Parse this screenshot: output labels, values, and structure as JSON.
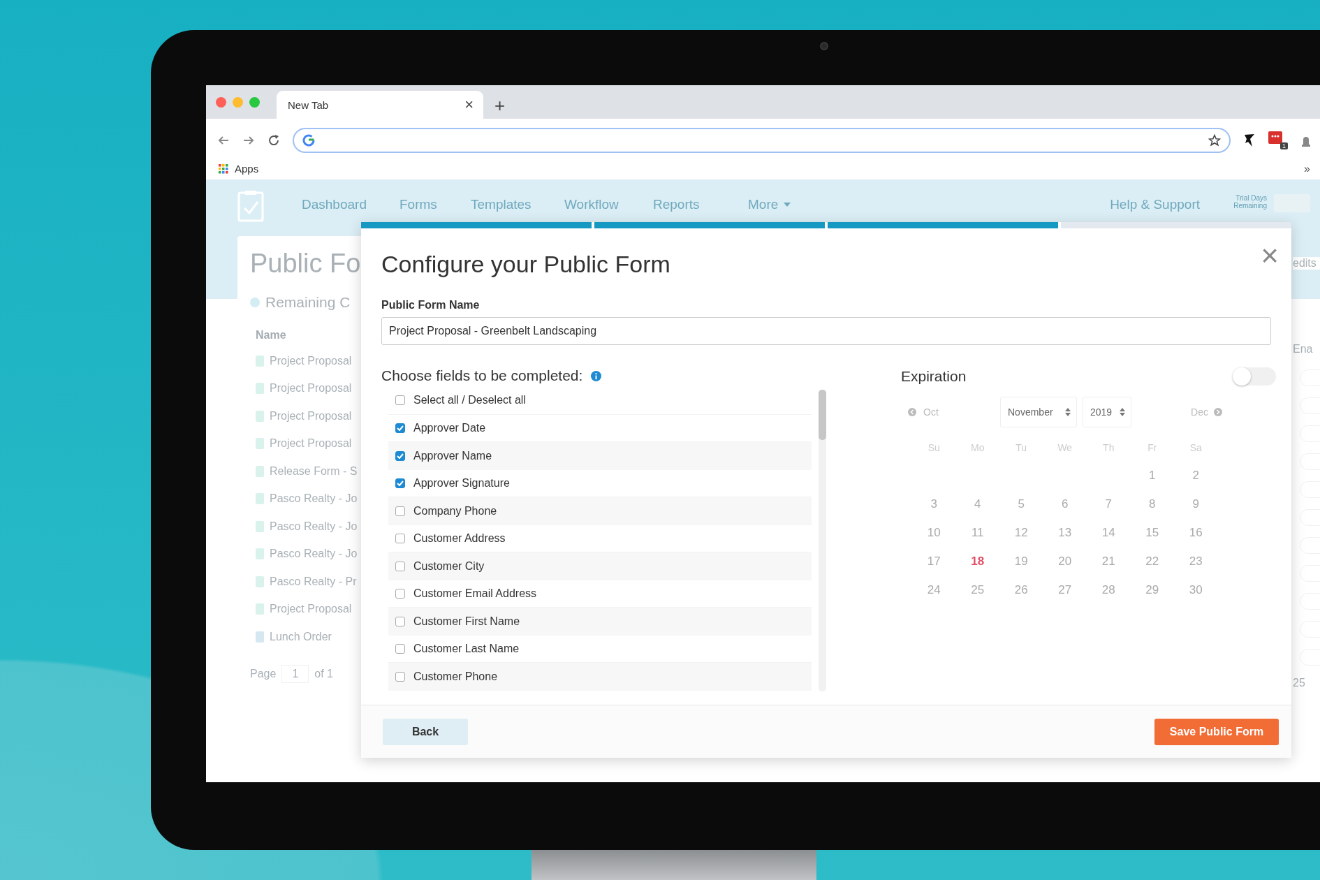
{
  "browser": {
    "tab": {
      "title": "New Tab",
      "close": "×"
    },
    "new_tab": "+",
    "extension_badge": "1",
    "bookmarks": [
      {
        "label": "Apps"
      }
    ],
    "overflow": "»"
  },
  "app": {
    "nav": [
      {
        "label": "Dashboard"
      },
      {
        "label": "Forms"
      },
      {
        "label": "Templates"
      },
      {
        "label": "Workflow"
      },
      {
        "label": "Reports"
      },
      {
        "label": "More"
      }
    ],
    "help": "Help & Support",
    "trial": "Trial Days Remaining"
  },
  "background_page": {
    "title": "Public Fo",
    "remaining": "Remaining C",
    "column": "Name",
    "rows": [
      {
        "name": "Project Proposal",
        "color": "#d9f3ec"
      },
      {
        "name": "Project Proposal",
        "color": "#d9f3ec"
      },
      {
        "name": "Project Proposal",
        "color": "#d9f3ec"
      },
      {
        "name": "Project Proposal",
        "color": "#d9f3ec"
      },
      {
        "name": "Release Form - S",
        "color": "#d9f3ec"
      },
      {
        "name": "Pasco Realty - Jo",
        "color": "#d9f3ec"
      },
      {
        "name": "Pasco Realty - Jo",
        "color": "#d9f3ec"
      },
      {
        "name": "Pasco Realty - Jo",
        "color": "#d9f3ec"
      },
      {
        "name": "Pasco Realty - Pr",
        "color": "#d9f3ec"
      },
      {
        "name": "Project Proposal",
        "color": "#d9f3ec"
      },
      {
        "name": "Lunch Order",
        "color": "#d5e8f2"
      }
    ],
    "pager": {
      "label": "Page",
      "value": "1",
      "total": "of 1"
    },
    "right": {
      "heading": "edits",
      "column": "Ena",
      "page_size": "25"
    }
  },
  "dialog": {
    "progress": [
      {
        "done": true
      },
      {
        "done": true
      },
      {
        "done": true
      },
      {
        "done": false
      }
    ],
    "title": "Configure your Public Form",
    "close": "×",
    "name_field": {
      "label": "Public Form Name",
      "value": "Project Proposal - Greenbelt Landscaping"
    },
    "fields": {
      "heading": "Choose fields to be completed:",
      "select_all": {
        "label": "Select all / Deselect all",
        "checked": false
      },
      "items": [
        {
          "label": "Approver Date",
          "checked": true
        },
        {
          "label": "Approver Name",
          "checked": true
        },
        {
          "label": "Approver Signature",
          "checked": true
        },
        {
          "label": "Company Phone",
          "checked": false
        },
        {
          "label": "Customer Address",
          "checked": false
        },
        {
          "label": "Customer City",
          "checked": false
        },
        {
          "label": "Customer Email Address",
          "checked": false
        },
        {
          "label": "Customer First Name",
          "checked": false
        },
        {
          "label": "Customer Last Name",
          "checked": false
        },
        {
          "label": "Customer Phone",
          "checked": false
        }
      ]
    },
    "expiration": {
      "heading": "Expiration",
      "on": false,
      "prev": "Oct",
      "month": "November",
      "year": "2019",
      "next": "Dec",
      "weekdays": [
        "Su",
        "Mo",
        "Tu",
        "We",
        "Th",
        "Fr",
        "Sa"
      ],
      "weeks": [
        [
          {
            "d": "1",
            "today": false
          },
          {
            "d": "2",
            "today": false
          }
        ],
        [
          {
            "d": "3",
            "today": false
          },
          {
            "d": "4",
            "today": false
          },
          {
            "d": "5",
            "today": false
          },
          {
            "d": "6",
            "today": false
          },
          {
            "d": "7",
            "today": false
          },
          {
            "d": "8",
            "today": false
          },
          {
            "d": "9",
            "today": false
          }
        ],
        [
          {
            "d": "10",
            "today": false
          },
          {
            "d": "11",
            "today": false
          },
          {
            "d": "12",
            "today": false
          },
          {
            "d": "13",
            "today": false
          },
          {
            "d": "14",
            "today": false
          },
          {
            "d": "15",
            "today": false
          },
          {
            "d": "16",
            "today": false
          }
        ],
        [
          {
            "d": "17",
            "today": false
          },
          {
            "d": "18",
            "today": true
          },
          {
            "d": "19",
            "today": false
          },
          {
            "d": "20",
            "today": false
          },
          {
            "d": "21",
            "today": false
          },
          {
            "d": "22",
            "today": false
          },
          {
            "d": "23",
            "today": false
          }
        ],
        [
          {
            "d": "24",
            "today": false
          },
          {
            "d": "25",
            "today": false
          },
          {
            "d": "26",
            "today": false
          },
          {
            "d": "27",
            "today": false
          },
          {
            "d": "28",
            "today": false
          },
          {
            "d": "29",
            "today": false
          },
          {
            "d": "30",
            "today": false
          }
        ]
      ]
    },
    "buttons": {
      "back": "Back",
      "save": "Save Public Form"
    }
  }
}
